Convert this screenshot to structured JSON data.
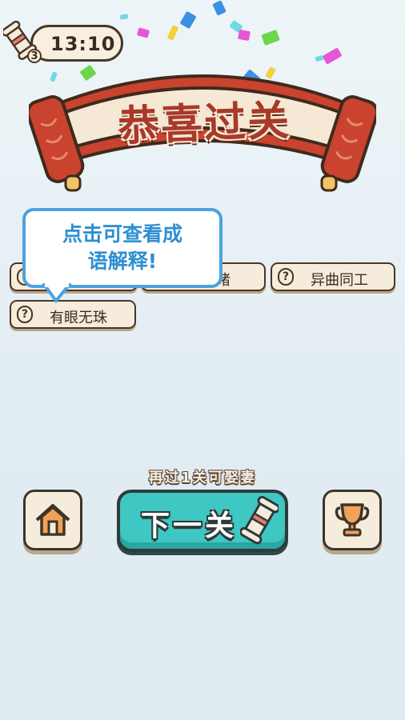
{
  "header": {
    "timer": "13:10",
    "scroll_count": "3"
  },
  "banner": {
    "title": "恭喜过关"
  },
  "idioms": [
    {
      "label": "",
      "hidden": true
    },
    {
      "label": "睹",
      "partial": true
    },
    {
      "label": "异曲同工"
    },
    {
      "label": "有眼无珠"
    }
  ],
  "tooltip": {
    "line1": "点击可查看成",
    "line2": "语解释!"
  },
  "footer": {
    "hint": "再过1关可娶妻",
    "next_label": "下一关",
    "home_icon": "home-icon",
    "trophy_icon": "trophy-icon"
  },
  "colors": {
    "banner_red": "#a83a2a",
    "teal": "#3fc7c3",
    "tooltip_blue": "#4aa3df",
    "cream": "#f6ecdc",
    "outline": "#4a3525"
  }
}
